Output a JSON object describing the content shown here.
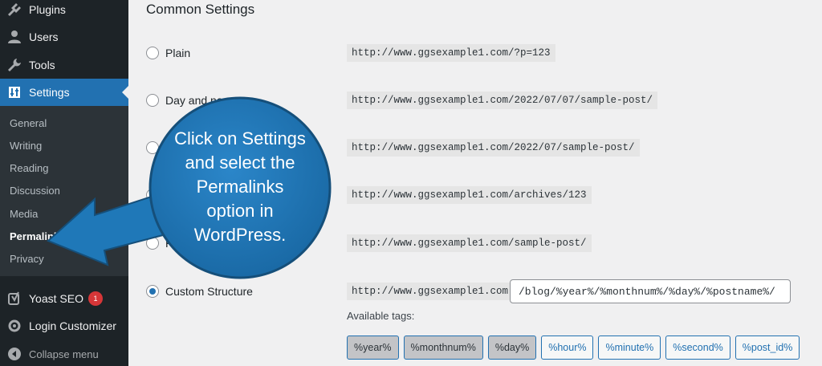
{
  "sidebar": {
    "items": {
      "plugins": "Plugins",
      "users": "Users",
      "tools": "Tools",
      "settings": "Settings",
      "yoast": "Yoast SEO",
      "yoast_badge": "1",
      "login_customizer": "Login Customizer",
      "collapse": "Collapse menu"
    },
    "submenu": [
      "General",
      "Writing",
      "Reading",
      "Discussion",
      "Media",
      "Permalinks",
      "Privacy"
    ]
  },
  "main": {
    "section_title": "Common Settings",
    "options": [
      {
        "label": "Plain",
        "url": "http://www.ggsexample1.com/?p=123"
      },
      {
        "label": "Day and na",
        "url": "http://www.ggsexample1.com/2022/07/07/sample-post/"
      },
      {
        "label": "",
        "url": "http://www.ggsexample1.com/2022/07/sample-post/"
      },
      {
        "label": "",
        "url": "http://www.ggsexample1.com/archives/123"
      },
      {
        "label": "Pos",
        "url": "http://www.ggsexample1.com/sample-post/"
      },
      {
        "label": "Custom Structure",
        "url": "http://www.ggsexample1.com"
      }
    ],
    "custom_value": "/blog/%year%/%monthnum%/%day%/%postname%/",
    "available_tags_label": "Available tags:",
    "tags": [
      "%year%",
      "%monthnum%",
      "%day%",
      "%hour%",
      "%minute%",
      "%second%",
      "%post_id%"
    ]
  },
  "callout": {
    "lines": [
      "Click on Settings",
      "and select the",
      "Permalinks",
      "option in",
      "WordPress."
    ]
  },
  "colors": {
    "sidebar_bg": "#1d2327",
    "accent": "#2271b1",
    "callout_bubble": "#1f78b8",
    "badge": "#d63638"
  }
}
